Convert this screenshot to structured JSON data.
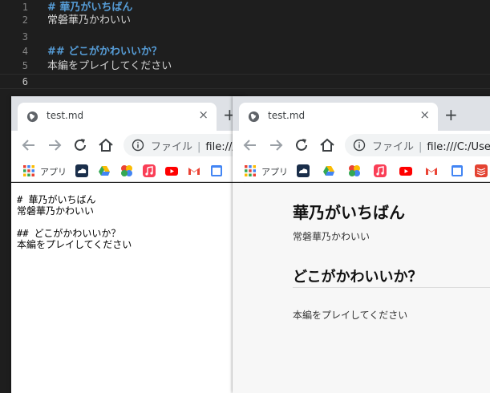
{
  "editor": {
    "lines": [
      {
        "num": "1",
        "text": "# 華乃がいちばん"
      },
      {
        "num": "2",
        "text": "常磐華乃かわいい"
      },
      {
        "num": "3",
        "text": ""
      },
      {
        "num": "4",
        "text": "## どこがかわいいか？"
      },
      {
        "num": "5",
        "text": "本編をプレイしてください"
      },
      {
        "num": "6",
        "text": ""
      }
    ]
  },
  "browser": {
    "tab_title": "test.md",
    "tab_close": "×",
    "new_tab": "+",
    "url_chip": "ファイル",
    "url_separator": "|",
    "url_left": "file:///C",
    "url_right": "file:///C:/Users",
    "bookmarks": {
      "apps_label": "アプリ"
    }
  },
  "raw_view": {
    "text": "# 華乃がいちばん\n常磐華乃かわいい\n\n## どこがかわいいか？\n本編をプレイしてください"
  },
  "rendered_view": {
    "h1": "華乃がいちばん",
    "p1": "常磐華乃かわいい",
    "h2": "どこがかわいいか？",
    "p2": "本編をプレイしてください"
  },
  "colors": {
    "editor_bg": "#1e1e1e",
    "heading": "#569cd6",
    "tabstrip": "#dee1e6"
  }
}
